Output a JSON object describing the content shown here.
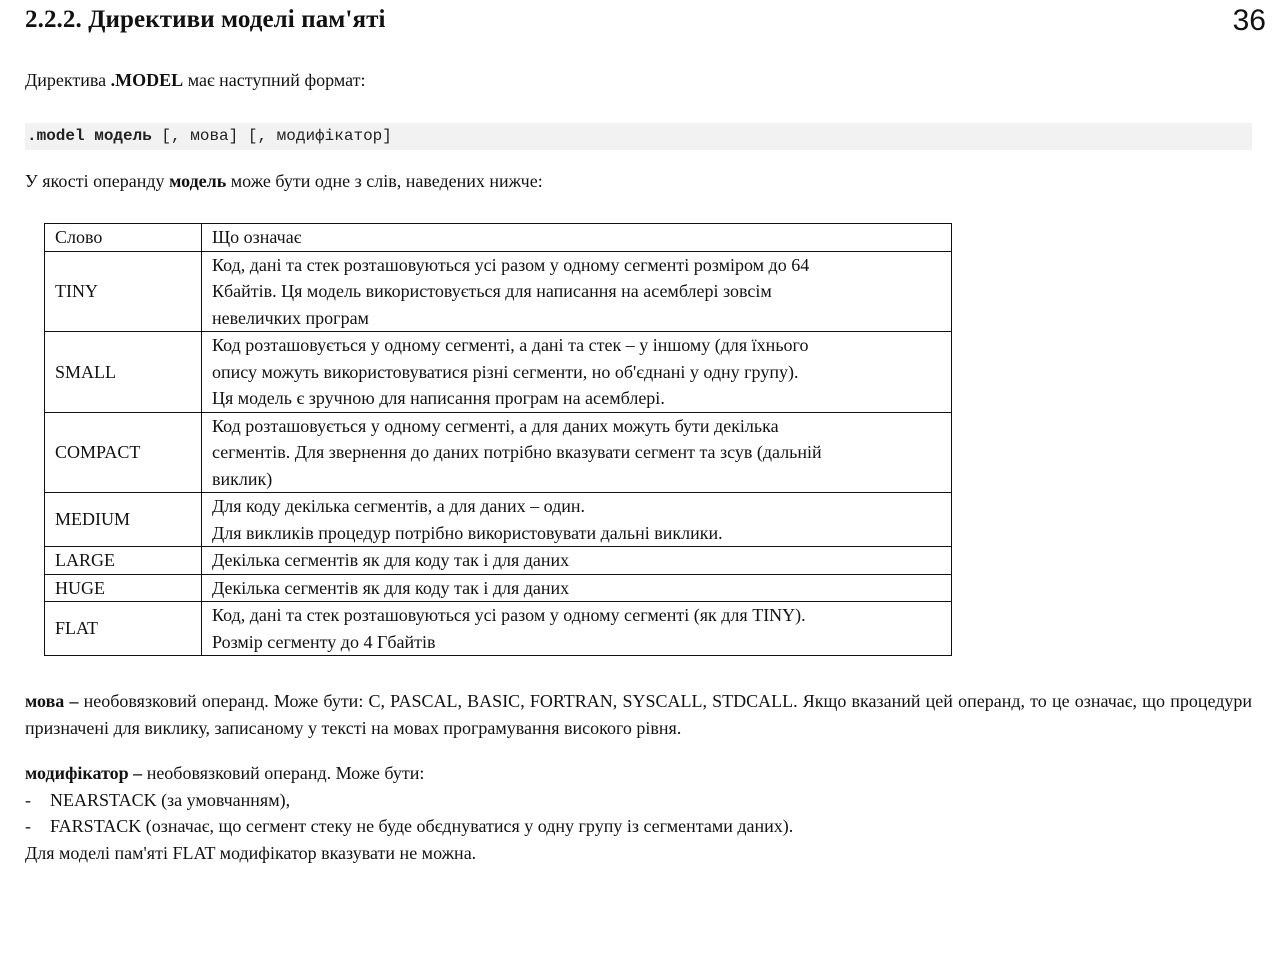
{
  "heading": "2.2.2. Директиви моделі пам'яті",
  "page_number": "36",
  "intro": {
    "prefix": "Директива ",
    "keyword": ".MODEL",
    "suffix": " має наступний формат:"
  },
  "code": {
    "kw1": ".model",
    "kw2": "модель",
    "rest": " [, мова] [, модифікатор]"
  },
  "operand_intro": {
    "prefix": "У якості операнду ",
    "keyword": "модель",
    "suffix": " може бути одне з слів, наведених нижче:"
  },
  "table": {
    "headers": [
      "Слово",
      "Що означає"
    ],
    "rows": [
      {
        "word": "TINY",
        "lines": [
          "Код, дані та стек розташовуються усі разом у одному сегменті розміром до 64",
          "Кбайтів. Ця модель використовується для написання на асемблері зовсім",
          "невеличких програм"
        ]
      },
      {
        "word": "SMALL",
        "lines": [
          "Код розташовується у одному сегменті, а дані та стек – у іншому (для їхнього",
          "опису можуть використовуватися різні сегменти, но об'єднані у одну групу).",
          "Ця модель є зручною для написання програм на асемблері."
        ]
      },
      {
        "word": "COMPACT",
        "lines": [
          "Код розташовується у одному сегменті, а для даних можуть бути декілька",
          "сегментів. Для звернення до даних потрібно вказувати сегмент та зсув (дальній",
          "виклик)"
        ]
      },
      {
        "word": "MEDIUM",
        "lines": [
          "Для коду декілька сегментів, а для даних – один.",
          "Для викликів процедур потрібно використовувати дальні виклики."
        ]
      },
      {
        "word": "LARGE",
        "lines": [
          "Декілька сегментів як для коду так і для даних"
        ]
      },
      {
        "word": "HUGE",
        "lines": [
          "Декілька сегментів як для коду так і для даних"
        ]
      },
      {
        "word": "FLAT",
        "lines": [
          "Код, дані та стек розташовуються усі разом у одному сегменті (як для TINY).",
          "Розмір сегменту до 4 Гбайтів"
        ]
      }
    ]
  },
  "lang_para": {
    "keyword": "мова –",
    "text": " необовязковий операнд. Може бути: C, PASCAL, BASIC, FORTRAN, SYSCALL, STDCALL. Якщо вказаний цей операнд, то це означає, що процедури призначені для виклику, записаному у тексті на мовах програмування високого рівня."
  },
  "mod_para": {
    "keyword": "модифікатор –",
    "text": " необовязковий операнд. Може бути:",
    "items": [
      "NEARSTACK (за умовчанням),",
      "FARSTACK (означає, що сегмент стеку не буде обєднуватися у одну групу із сегментами даних)."
    ],
    "bullet": "-",
    "footer": "Для моделі пам'яті FLAT модифікатор вказувати не можна."
  }
}
